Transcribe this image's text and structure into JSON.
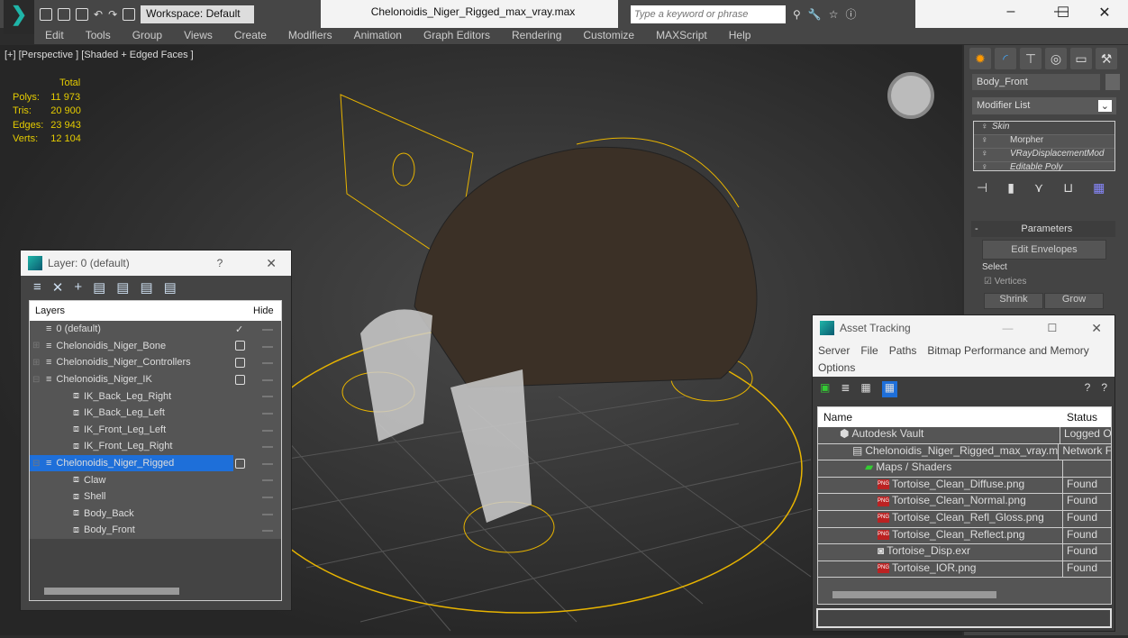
{
  "app": {
    "title": "Chelonoidis_Niger_Rigged_max_vray.max",
    "workspace": "Workspace: Default",
    "search_placeholder": "Type a keyword or phrase"
  },
  "menu": [
    "Edit",
    "Tools",
    "Group",
    "Views",
    "Create",
    "Modifiers",
    "Animation",
    "Graph Editors",
    "Rendering",
    "Customize",
    "MAXScript",
    "Help"
  ],
  "viewport": {
    "label": "[+] [Perspective ] [Shaded + Edged Faces ]",
    "stats": {
      "header": "Total",
      "rows": [
        [
          "Polys:",
          "11 973"
        ],
        [
          "Tris:",
          "20 900"
        ],
        [
          "Edges:",
          "23 943"
        ],
        [
          "Verts:",
          "12 104"
        ]
      ]
    }
  },
  "command_panel": {
    "object_name": "Body_Front",
    "modifier_list": "Modifier List",
    "stack": [
      "Skin",
      "Morpher",
      "VRayDisplacementMod",
      "Editable Poly"
    ],
    "rollout": "Parameters",
    "edit_envelopes": "Edit Envelopes",
    "select_label": "Select",
    "vertices": "Vertices",
    "shrink": "Shrink",
    "grow": "Grow"
  },
  "layer_dialog": {
    "title": "Layer: 0 (default)",
    "help": "?",
    "col_layers": "Layers",
    "col_hide": "Hide",
    "rows": [
      {
        "name": "0 (default)",
        "level": 0,
        "type": "layer",
        "current": true
      },
      {
        "name": "Chelonoidis_Niger_Bone",
        "level": 0,
        "type": "layer",
        "expand": "+"
      },
      {
        "name": "Chelonoidis_Niger_Controllers",
        "level": 0,
        "type": "layer",
        "expand": "+"
      },
      {
        "name": "Chelonoidis_Niger_IK",
        "level": 0,
        "type": "layer",
        "expand": "-"
      },
      {
        "name": "IK_Back_Leg_Right",
        "level": 1,
        "type": "object"
      },
      {
        "name": "IK_Back_Leg_Left",
        "level": 1,
        "type": "object"
      },
      {
        "name": "IK_Front_Leg_Left",
        "level": 1,
        "type": "object"
      },
      {
        "name": "IK_Front_Leg_Right",
        "level": 1,
        "type": "object"
      },
      {
        "name": "Chelonoidis_Niger_Rigged",
        "level": 0,
        "type": "layer",
        "expand": "-",
        "selected": true
      },
      {
        "name": "Claw",
        "level": 1,
        "type": "object"
      },
      {
        "name": "Shell",
        "level": 1,
        "type": "object"
      },
      {
        "name": "Body_Back",
        "level": 1,
        "type": "object"
      },
      {
        "name": "Body_Front",
        "level": 1,
        "type": "object"
      }
    ]
  },
  "asset_tracking": {
    "title": "Asset Tracking",
    "menu": [
      "Server",
      "File",
      "Paths",
      "Bitmap Performance and Memory",
      "Options"
    ],
    "col_name": "Name",
    "col_status": "Status",
    "rows": [
      {
        "name": "Autodesk Vault",
        "status": "Logged O",
        "level": 1,
        "icon": "vault"
      },
      {
        "name": "Chelonoidis_Niger_Rigged_max_vray.max",
        "status": "Network F",
        "level": 2,
        "icon": "max"
      },
      {
        "name": "Maps / Shaders",
        "status": "",
        "level": 3,
        "icon": "maps"
      },
      {
        "name": "Tortoise_Clean_Diffuse.png",
        "status": "Found",
        "level": 4,
        "icon": "png"
      },
      {
        "name": "Tortoise_Clean_Normal.png",
        "status": "Found",
        "level": 4,
        "icon": "png"
      },
      {
        "name": "Tortoise_Clean_Refl_Gloss.png",
        "status": "Found",
        "level": 4,
        "icon": "png"
      },
      {
        "name": "Tortoise_Clean_Reflect.png",
        "status": "Found",
        "level": 4,
        "icon": "png"
      },
      {
        "name": "Tortoise_Disp.exr",
        "status": "Found",
        "level": 4,
        "icon": "exr"
      },
      {
        "name": "Tortoise_IOR.png",
        "status": "Found",
        "level": 4,
        "icon": "png"
      }
    ]
  },
  "colors": {
    "accent": "#1e6fd9",
    "stats": "#e5cc00",
    "wire": "#e8b400"
  }
}
